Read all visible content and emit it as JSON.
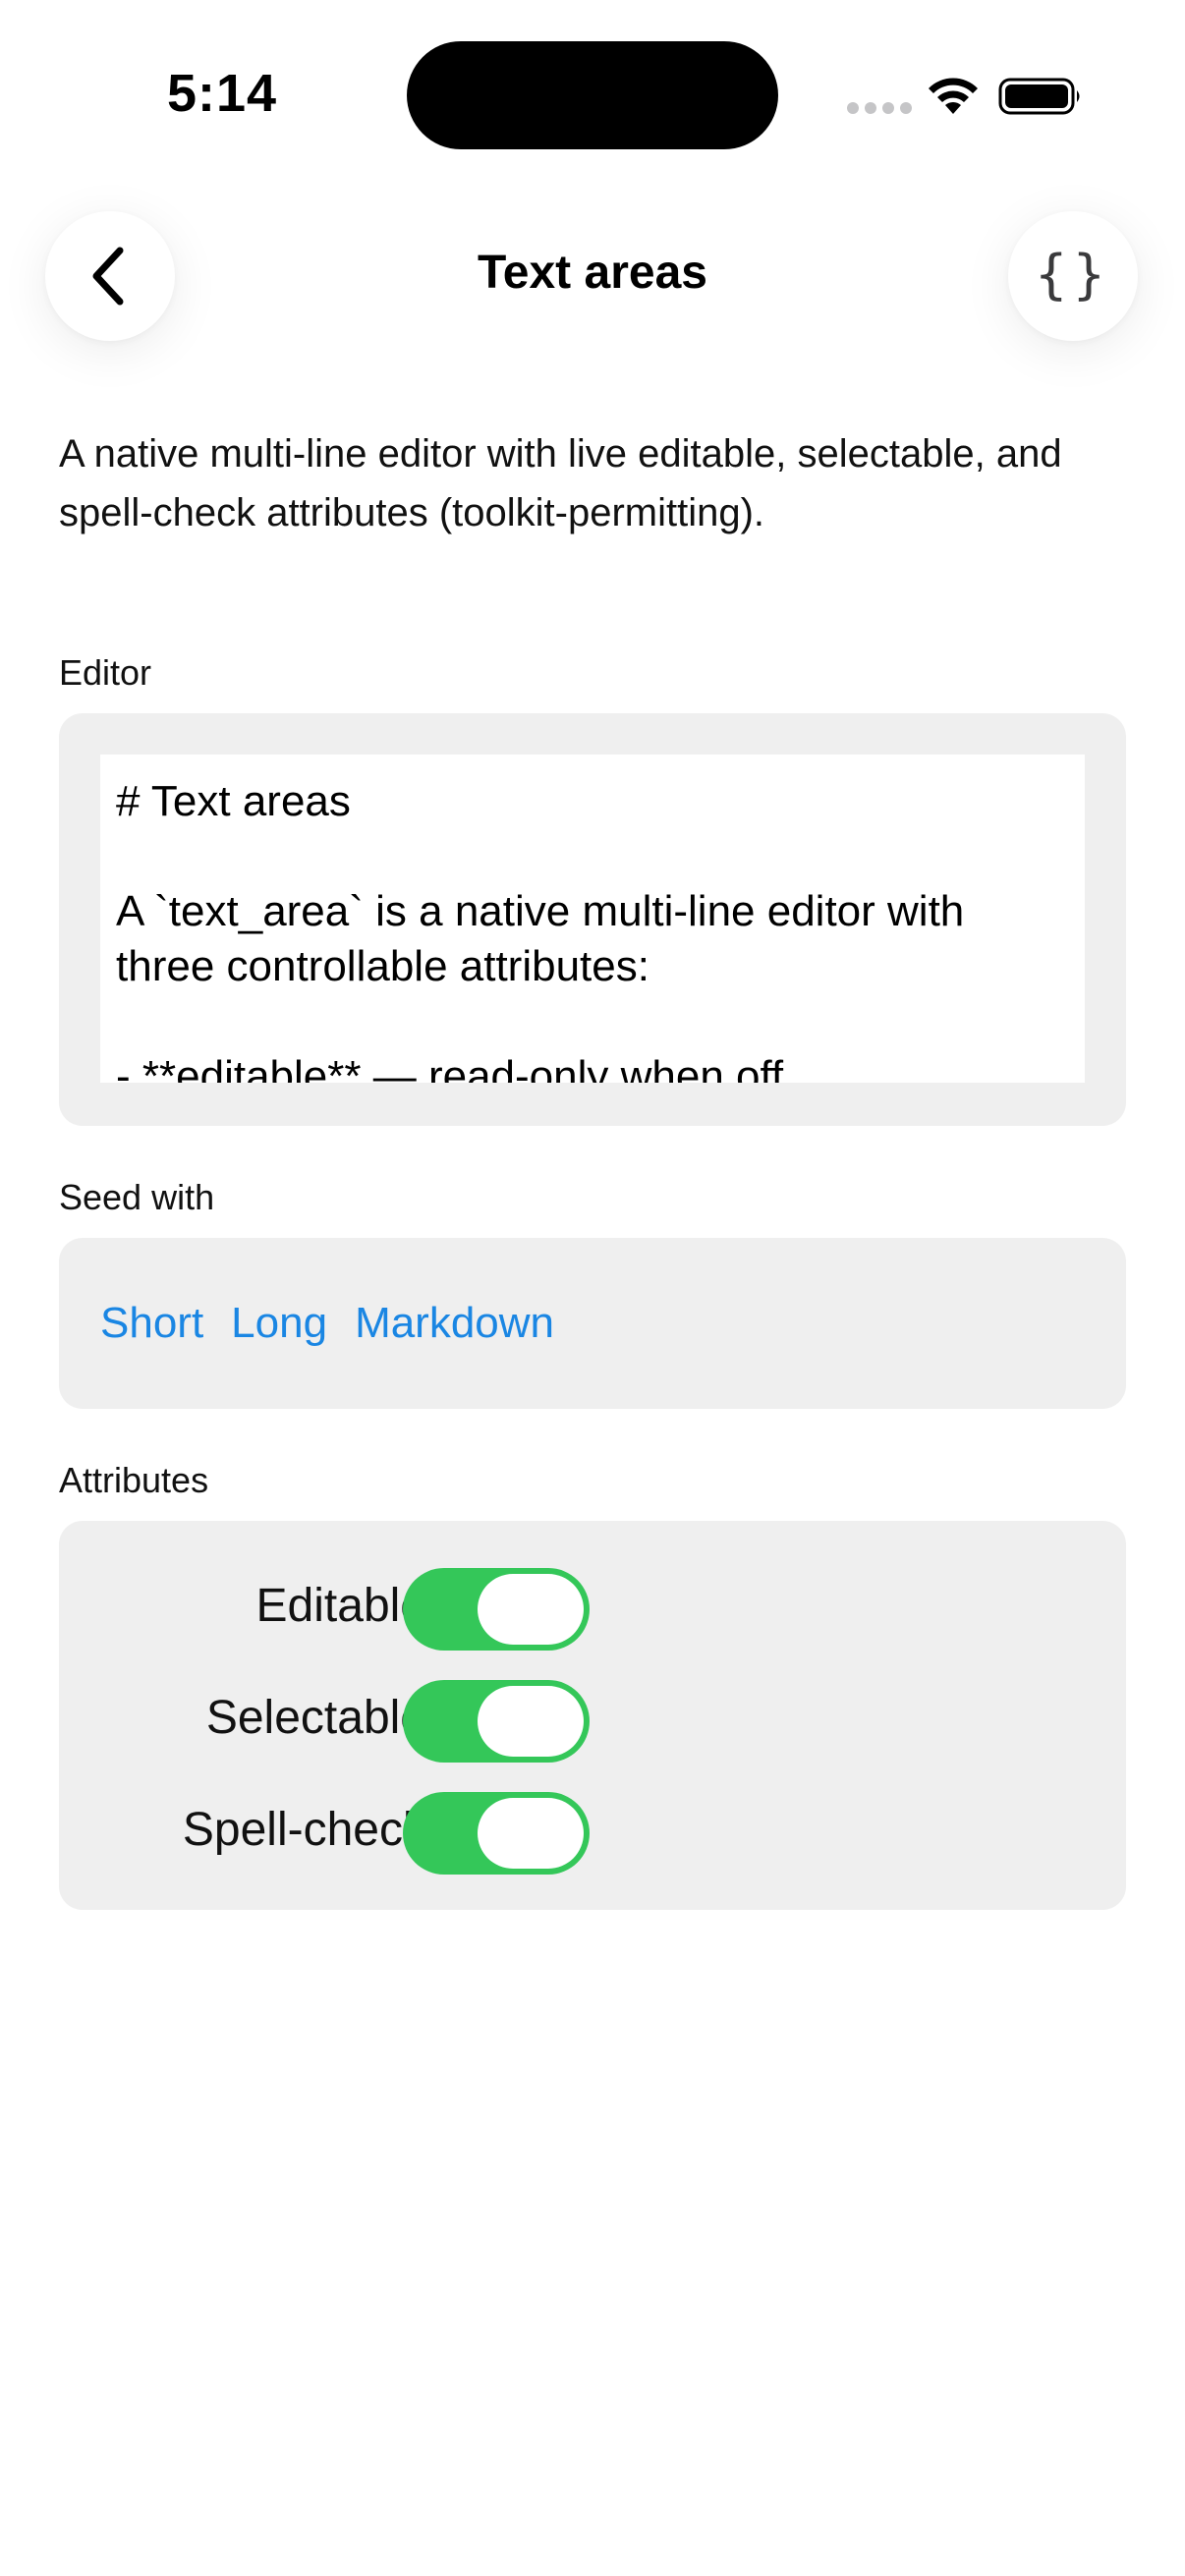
{
  "status_bar": {
    "time": "5:14"
  },
  "nav": {
    "title": "Text areas",
    "back_icon": "chevron-left-icon",
    "code_icon": "curly-braces-icon",
    "code_glyph": "{}"
  },
  "description": "A native multi-line editor with live editable, selectable, and spell-check attributes (toolkit-permitting).",
  "editor": {
    "label": "Editor",
    "content": "# Text areas\n\nA `text_area` is a native multi-line editor with three controllable attributes:\n\n- **editable** — read-only when off"
  },
  "seed": {
    "label": "Seed with",
    "options": [
      "Short",
      "Long",
      "Markdown"
    ]
  },
  "attributes": {
    "label": "Attributes",
    "toggles": [
      {
        "label": "Editable",
        "on": true
      },
      {
        "label": "Selectable",
        "on": true
      },
      {
        "label": "Spell-check",
        "on": true
      }
    ]
  },
  "colors": {
    "accent_link": "#1a86e3",
    "toggle_on": "#34c759",
    "card_background": "#efefef"
  }
}
